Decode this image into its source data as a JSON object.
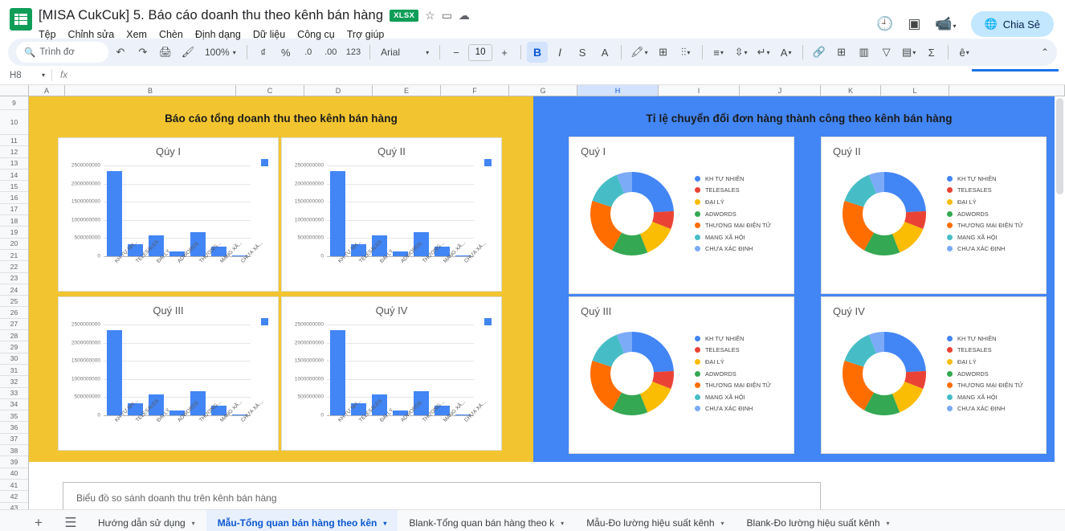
{
  "header": {
    "doc_title": "[MISA CukCuk] 5. Báo cáo doanh thu theo kênh bán hàng",
    "format_badge": "XLSX",
    "star_icon": "☆",
    "move_icon": "▭",
    "cloud_icon": "☁",
    "menu": [
      "Tệp",
      "Chỉnh sửa",
      "Xem",
      "Chèn",
      "Định dạng",
      "Dữ liệu",
      "Công cụ",
      "Trợ giúp"
    ],
    "history_icon": "🕘",
    "comment_icon": "▣",
    "meet_icon": "📹",
    "share_label": "Chia Sẻ",
    "share_icon": "🌐"
  },
  "toolbar": {
    "search_placeholder": "Trình đơ",
    "search_icon": "🔍",
    "undo_icon": "↶",
    "redo_icon": "↷",
    "print_icon": "🖨",
    "paint_icon": "🖌",
    "zoom_value": "100%",
    "currency_icon": "₫",
    "percent_icon": "%",
    "dec_decrease": ".0",
    "dec_increase": ".00",
    "number_format": "123",
    "font_name": "Arial",
    "minus": "−",
    "font_size": "10",
    "plus": "+",
    "bold": "B",
    "italic": "I",
    "strike": "S",
    "text_color": "A",
    "fill_color": "🖍",
    "borders_icon": "⊞",
    "merge_icon": "⫶⫶",
    "halign_icon": "≡",
    "valign_icon": "⇳",
    "wrap_icon": "↵",
    "rotate_icon": "A",
    "link_icon": "🔗",
    "comment_icon": "⊞",
    "chart_icon": "▥",
    "filter_icon": "▽",
    "filterview_icon": "▤",
    "functions_icon": "Σ",
    "input_tools_icon": "ê",
    "collapse_icon": "⌃"
  },
  "formula_bar": {
    "cell_ref": "H8",
    "fx_label": "fx",
    "value": ""
  },
  "grid": {
    "columns": [
      "A",
      "B",
      "C",
      "D",
      "E",
      "F",
      "G",
      "H",
      "I",
      "J",
      "K",
      "L"
    ],
    "selected_column": "H",
    "rows": [
      9,
      10,
      11,
      12,
      13,
      14,
      15,
      16,
      17,
      18,
      19,
      20,
      21,
      22,
      23,
      24,
      25,
      26,
      27,
      28,
      29,
      30,
      31,
      32,
      33,
      34,
      35,
      36,
      37,
      38,
      39,
      40,
      41,
      42,
      43
    ]
  },
  "panels": {
    "left_title": "Báo cáo tổng doanh thu theo kênh bán hàng",
    "right_title": "Tỉ lệ chuyển đổi đơn hàng thành công theo kênh bán hàng",
    "left_bg": "#F2C530",
    "right_bg": "#4285F4"
  },
  "bottom_chart": {
    "title": "Biểu đồ so sánh doanh thu trên kênh bán hàng"
  },
  "tabs": {
    "add_icon": "+",
    "all_sheets_icon": "☰",
    "items": [
      {
        "label": "Hướng dẫn sử dụng",
        "active": false,
        "caret": "▾"
      },
      {
        "label": "Mẫu-Tổng quan bán hàng theo kên",
        "active": true,
        "caret": "▾"
      },
      {
        "label": "Blank-Tổng quan bán hàng theo k",
        "active": false,
        "caret": "▾"
      },
      {
        "label": "Mẫu-Đo lường hiệu suất kênh",
        "active": false,
        "caret": "▾"
      },
      {
        "label": "Blank-Đo lường hiệu suất kênh",
        "active": false,
        "caret": "▾"
      }
    ]
  },
  "chart_data": [
    {
      "type": "bar",
      "title": "Qúy I",
      "categories": [
        "KH TỰ NH...",
        "TELESALES",
        "ĐẠI LÝ",
        "ADWORDS",
        "THƯƠNG...",
        "MẠNG XÃ...",
        "CHƯA XÁ..."
      ],
      "values": [
        2350000000,
        340000000,
        580000000,
        130000000,
        655000000,
        265000000,
        15000000
      ],
      "ylabel": "",
      "xlabel": "",
      "ylim": [
        0,
        2500000000
      ],
      "yticks": [
        "2500000000",
        "2000000000",
        "1500000000",
        "1000000000",
        "500000000",
        "0"
      ],
      "grid": true,
      "series_color": "#4285F4",
      "legend_position": "right"
    },
    {
      "type": "bar",
      "title": "Quý II",
      "categories": [
        "KH TỰ NH...",
        "TELESALES",
        "ĐẠI LÝ",
        "ADWORDS",
        "THƯƠNG...",
        "MẠNG XÃ...",
        "CHƯA XÁ..."
      ],
      "values": [
        2350000000,
        340000000,
        580000000,
        130000000,
        655000000,
        265000000,
        15000000
      ],
      "ylim": [
        0,
        2500000000
      ],
      "yticks": [
        "2500000000",
        "2000000000",
        "1500000000",
        "1000000000",
        "500000000",
        "0"
      ],
      "grid": true,
      "series_color": "#4285F4",
      "legend_position": "right"
    },
    {
      "type": "bar",
      "title": "Quý III",
      "categories": [
        "KH TỰ NH...",
        "TELESALES",
        "ĐẠI LÝ",
        "ADWORDS",
        "THƯƠNG...",
        "MẠNG XÃ...",
        "CHƯA XÁ..."
      ],
      "values": [
        2350000000,
        340000000,
        580000000,
        130000000,
        655000000,
        265000000,
        15000000
      ],
      "ylim": [
        0,
        2500000000
      ],
      "yticks": [
        "2500000000",
        "2000000000",
        "1500000000",
        "1000000000",
        "500000000",
        "0"
      ],
      "grid": true,
      "series_color": "#4285F4",
      "legend_position": "right"
    },
    {
      "type": "bar",
      "title": "Quý IV",
      "categories": [
        "KH TỰ NH...",
        "TELESALES",
        "ĐẠI LÝ",
        "ADWORDS",
        "THƯƠNG...",
        "MẠNG XÃ...",
        "CHƯA XÁ..."
      ],
      "values": [
        2350000000,
        340000000,
        580000000,
        130000000,
        655000000,
        265000000,
        15000000
      ],
      "ylim": [
        0,
        2500000000
      ],
      "yticks": [
        "2500000000",
        "2000000000",
        "1500000000",
        "1000000000",
        "500000000",
        "0"
      ],
      "grid": true,
      "series_color": "#4285F4",
      "legend_position": "right"
    },
    {
      "type": "pie",
      "variant": "donut",
      "title": "Quý I",
      "labels": [
        "KH TỰ NHIÊN",
        "TELESALES",
        "ĐẠI LÝ",
        "ADWORDS",
        "THƯƠNG MẠI ĐIỆN TỬ",
        "MẠNG XÃ HỘI",
        "CHƯA XÁC ĐỊNH"
      ],
      "values": [
        24,
        7,
        13,
        14,
        22,
        14,
        6
      ],
      "colors": [
        "#4285F4",
        "#EA4335",
        "#FBBC04",
        "#34A853",
        "#FF6D01",
        "#46BDC6",
        "#7BAAF7"
      ],
      "legend_position": "right"
    },
    {
      "type": "pie",
      "variant": "donut",
      "title": "Quý II",
      "labels": [
        "KH TỰ NHIÊN",
        "TELESALES",
        "ĐẠI LÝ",
        "ADWORDS",
        "THƯƠNG MẠI ĐIỆN TỬ",
        "MẠNG XÃ HỘI",
        "CHƯA XÁC ĐỊNH"
      ],
      "values": [
        24,
        7,
        13,
        14,
        22,
        14,
        6
      ],
      "colors": [
        "#4285F4",
        "#EA4335",
        "#FBBC04",
        "#34A853",
        "#FF6D01",
        "#46BDC6",
        "#7BAAF7"
      ],
      "legend_position": "right"
    },
    {
      "type": "pie",
      "variant": "donut",
      "title": "Quý III",
      "labels": [
        "KH TỰ NHIÊN",
        "TELESALES",
        "ĐẠI LÝ",
        "ADWORDS",
        "THƯƠNG MẠI ĐIỆN TỬ",
        "MẠNG XÃ HỘI",
        "CHƯA XÁC ĐỊNH"
      ],
      "values": [
        24,
        7,
        13,
        14,
        22,
        14,
        6
      ],
      "colors": [
        "#4285F4",
        "#EA4335",
        "#FBBC04",
        "#34A853",
        "#FF6D01",
        "#46BDC6",
        "#7BAAF7"
      ],
      "legend_position": "right"
    },
    {
      "type": "pie",
      "variant": "donut",
      "title": "Quý IV",
      "labels": [
        "KH TỰ NHIÊN",
        "TELESALES",
        "ĐẠI LÝ",
        "ADWORDS",
        "THƯƠNG MẠI ĐIỆN TỬ",
        "MẠNG XÃ HỘI",
        "CHƯA XÁC ĐỊNH"
      ],
      "values": [
        24,
        7,
        13,
        14,
        22,
        14,
        6
      ],
      "colors": [
        "#4285F4",
        "#EA4335",
        "#FBBC04",
        "#34A853",
        "#FF6D01",
        "#46BDC6",
        "#7BAAF7"
      ],
      "legend_position": "right"
    }
  ]
}
